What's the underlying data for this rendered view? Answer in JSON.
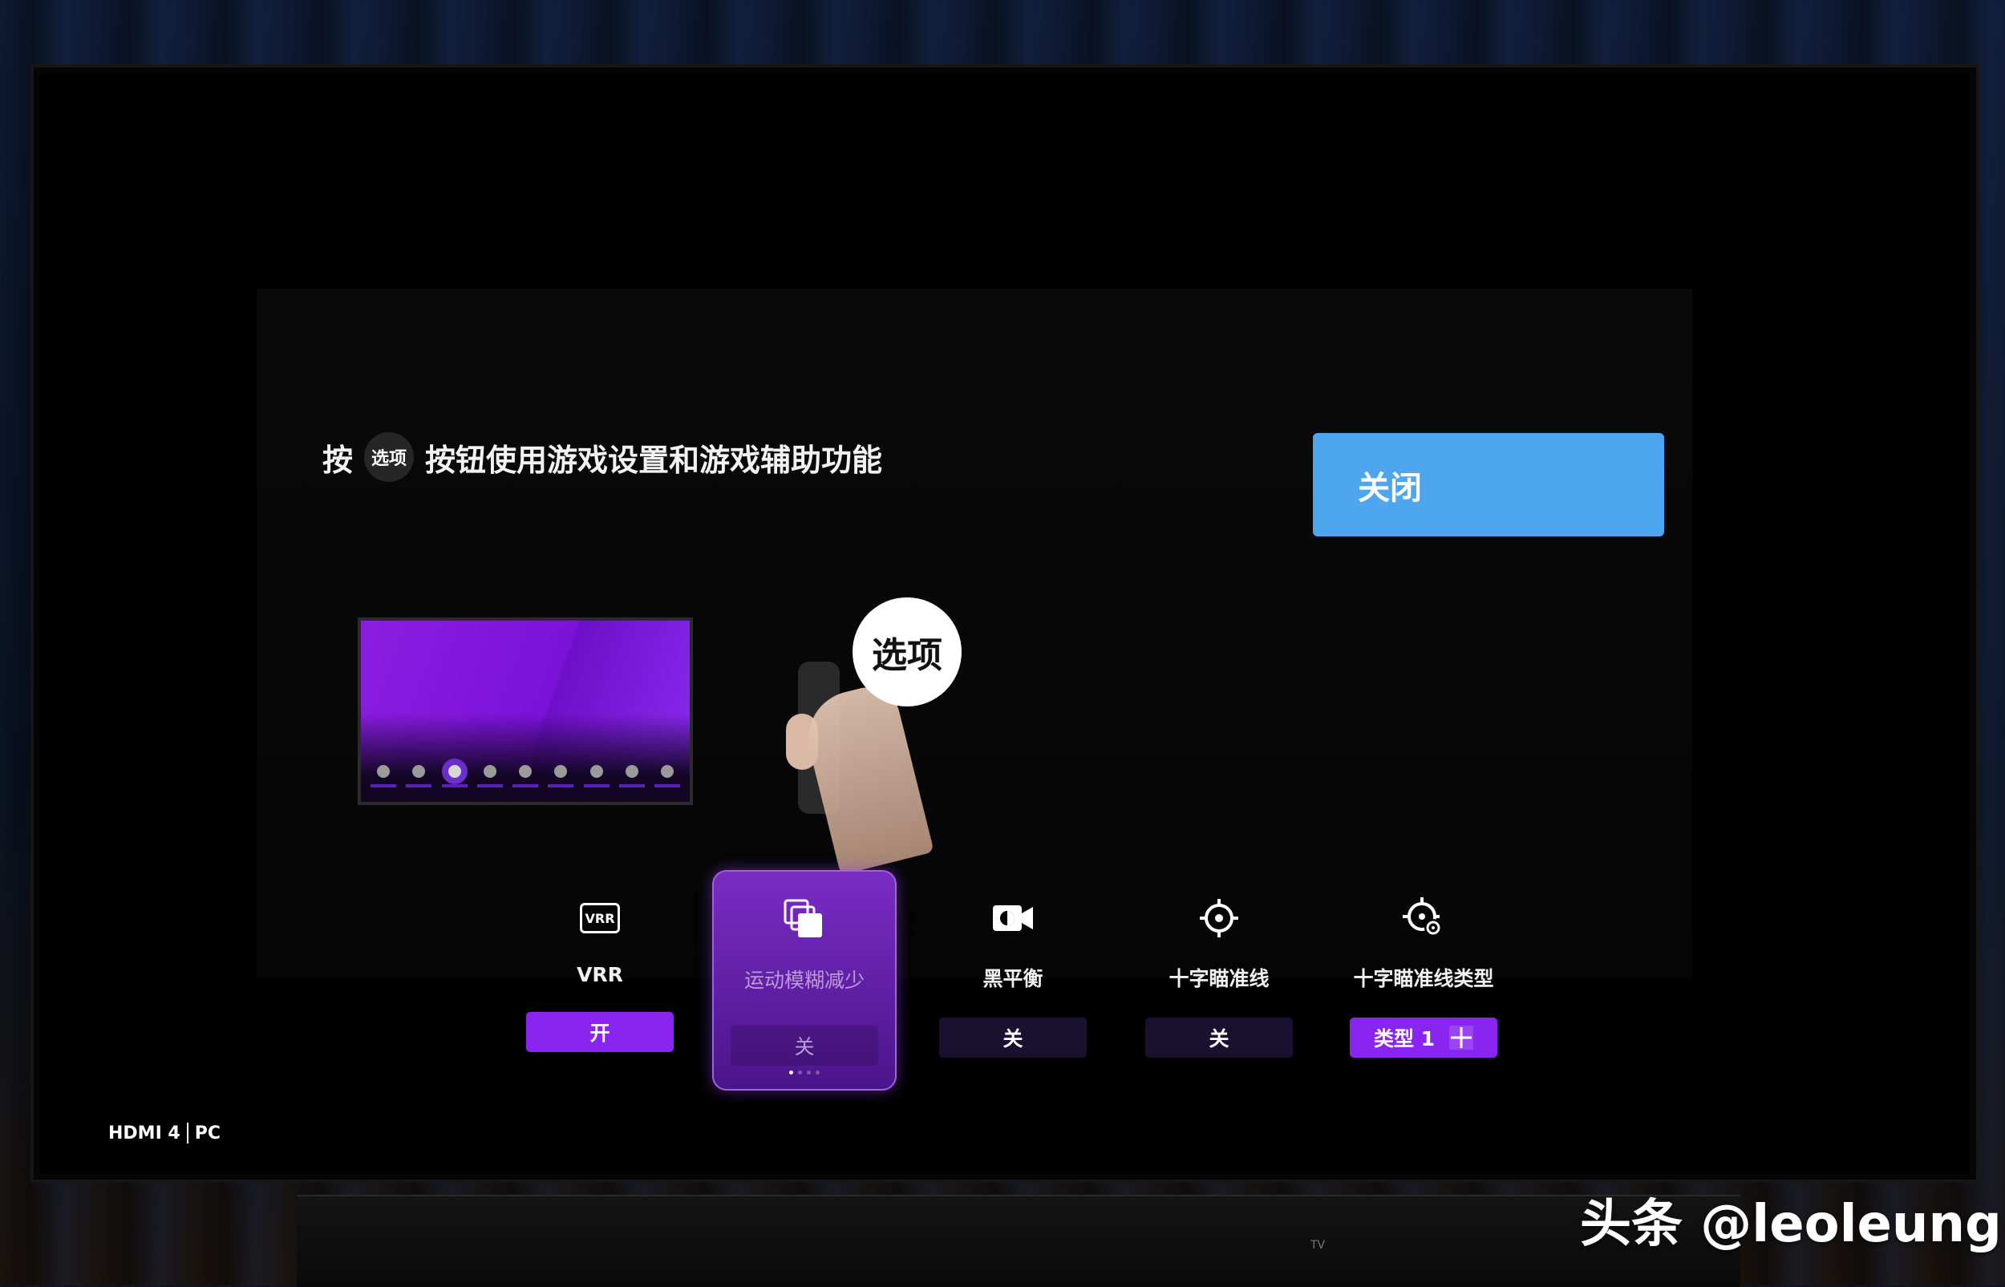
{
  "headline": {
    "prefix": "按",
    "key_label": "选项",
    "suffix": "按钮使用游戏设置和游戏辅助功能"
  },
  "close_button": {
    "label": "关闭"
  },
  "illustration": {
    "bubble_label": "选项"
  },
  "tiles": [
    {
      "label": "VRR",
      "value": "开",
      "icon": "vrr-icon",
      "icon_text": "VRR",
      "state": "on"
    },
    {
      "label": "运动模糊减少",
      "value": "关",
      "icon": "copy-layers-icon",
      "state": "off"
    },
    {
      "label": "黑平衡",
      "value": "关",
      "icon": "camera-icon",
      "state": "off"
    },
    {
      "label": "十字瞄准线",
      "value": "关",
      "icon": "crosshair-icon",
      "state": "off"
    },
    {
      "label": "十字瞄准线类型",
      "value": "类型 1",
      "icon": "crosshair-gear-icon",
      "state": "on"
    }
  ],
  "input_source": {
    "port": "HDMI 4",
    "mode": "PC"
  },
  "stand_label": "TV",
  "watermark": "头条 @leoleung",
  "colors": {
    "accent": "#8a24f0",
    "close": "#4ea6ef",
    "focus": "#7a2cc4"
  }
}
